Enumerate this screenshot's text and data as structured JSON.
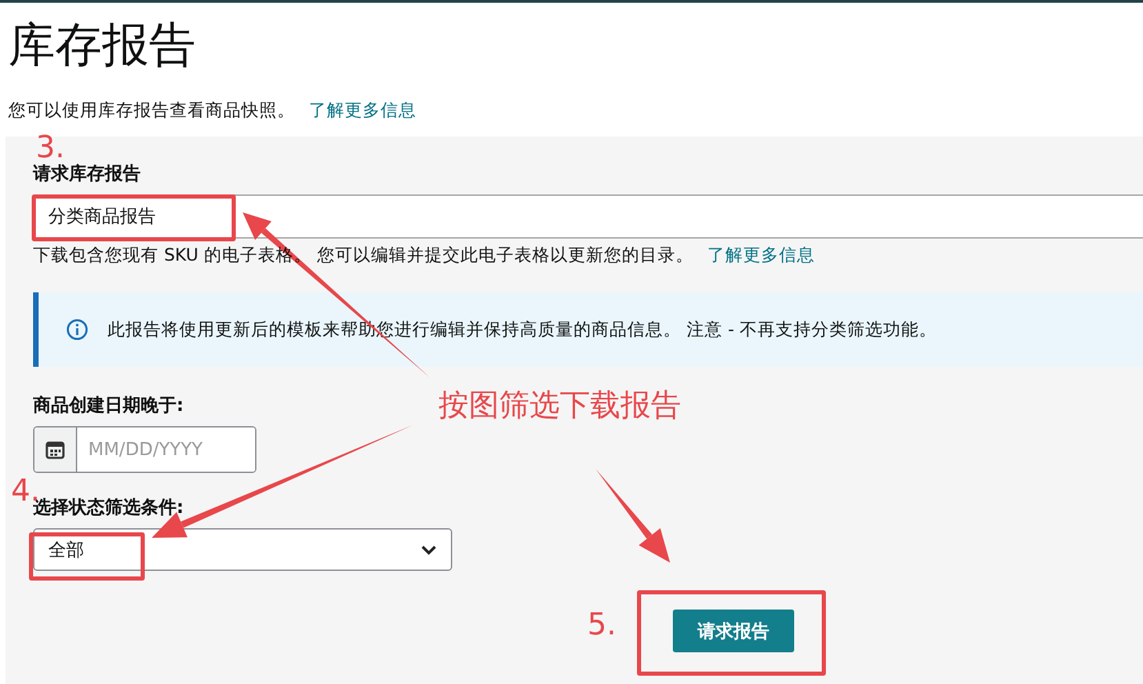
{
  "page": {
    "title": "库存报告",
    "intro": "您可以使用库存报告查看商品快照。",
    "intro_link": "了解更多信息"
  },
  "form": {
    "report_label": "请求库存报告",
    "report_value": "分类商品报告",
    "report_help": "下载包含您现有 SKU 的电子表格。 您可以编辑并提交此电子表格以更新您的目录。",
    "report_help_link": "了解更多信息",
    "info": "此报告将使用更新后的模板来帮助您进行编辑并保持高质量的商品信息。 注意 - 不再支持分类筛选功能。",
    "date_label": "商品创建日期晚于:",
    "date_placeholder": "MM/DD/YYYY",
    "status_label": "选择状态筛选条件:",
    "status_value": "全部",
    "submit": "请求报告"
  },
  "annotations": {
    "steps": [
      "3.",
      "4.",
      "5."
    ],
    "caption": "按图筛选下载报告"
  }
}
